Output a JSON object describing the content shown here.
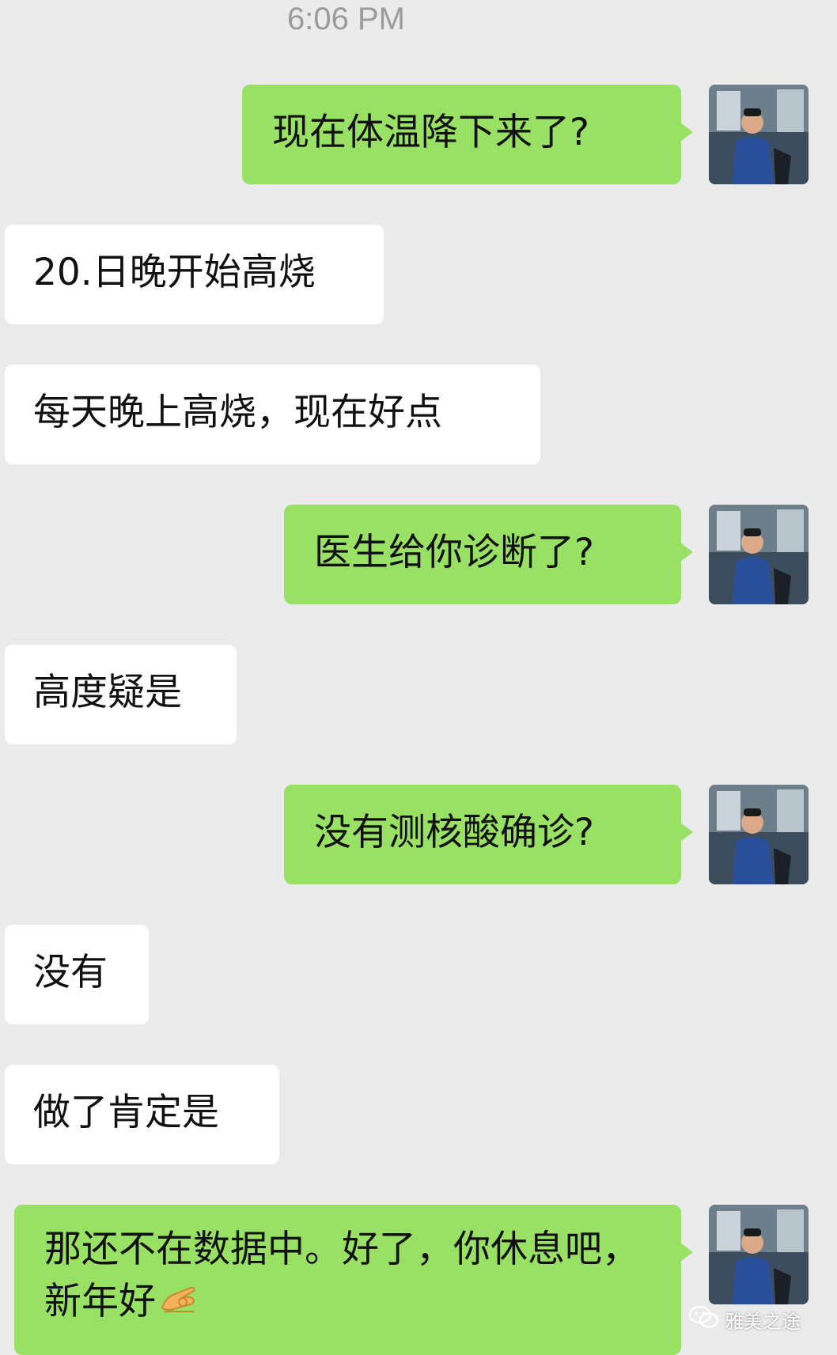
{
  "chat": {
    "timestamp": "6:06 PM",
    "messages": [
      {
        "side": "out",
        "text": "现在体温降下来了?"
      },
      {
        "side": "in",
        "text": "20.日晚开始高烧"
      },
      {
        "side": "in",
        "text": "每天晚上高烧，现在好点"
      },
      {
        "side": "out",
        "text": "医生给你诊断了?"
      },
      {
        "side": "in",
        "text": "高度疑是"
      },
      {
        "side": "out",
        "text": "没有测核酸确诊?"
      },
      {
        "side": "in",
        "text": "没有"
      },
      {
        "side": "in",
        "text": "做了肯定是"
      },
      {
        "side": "out",
        "text": "那还不在数据中。好了，你休息吧，新年好",
        "emoji": "ok-hand-emoji"
      }
    ]
  },
  "watermark": {
    "text": "雅美之途",
    "icon": "wechat-icon"
  },
  "colors": {
    "background": "#ebebeb",
    "outgoing_bubble": "#98e165",
    "incoming_bubble": "#ffffff",
    "timestamp": "#9b9b9b"
  }
}
